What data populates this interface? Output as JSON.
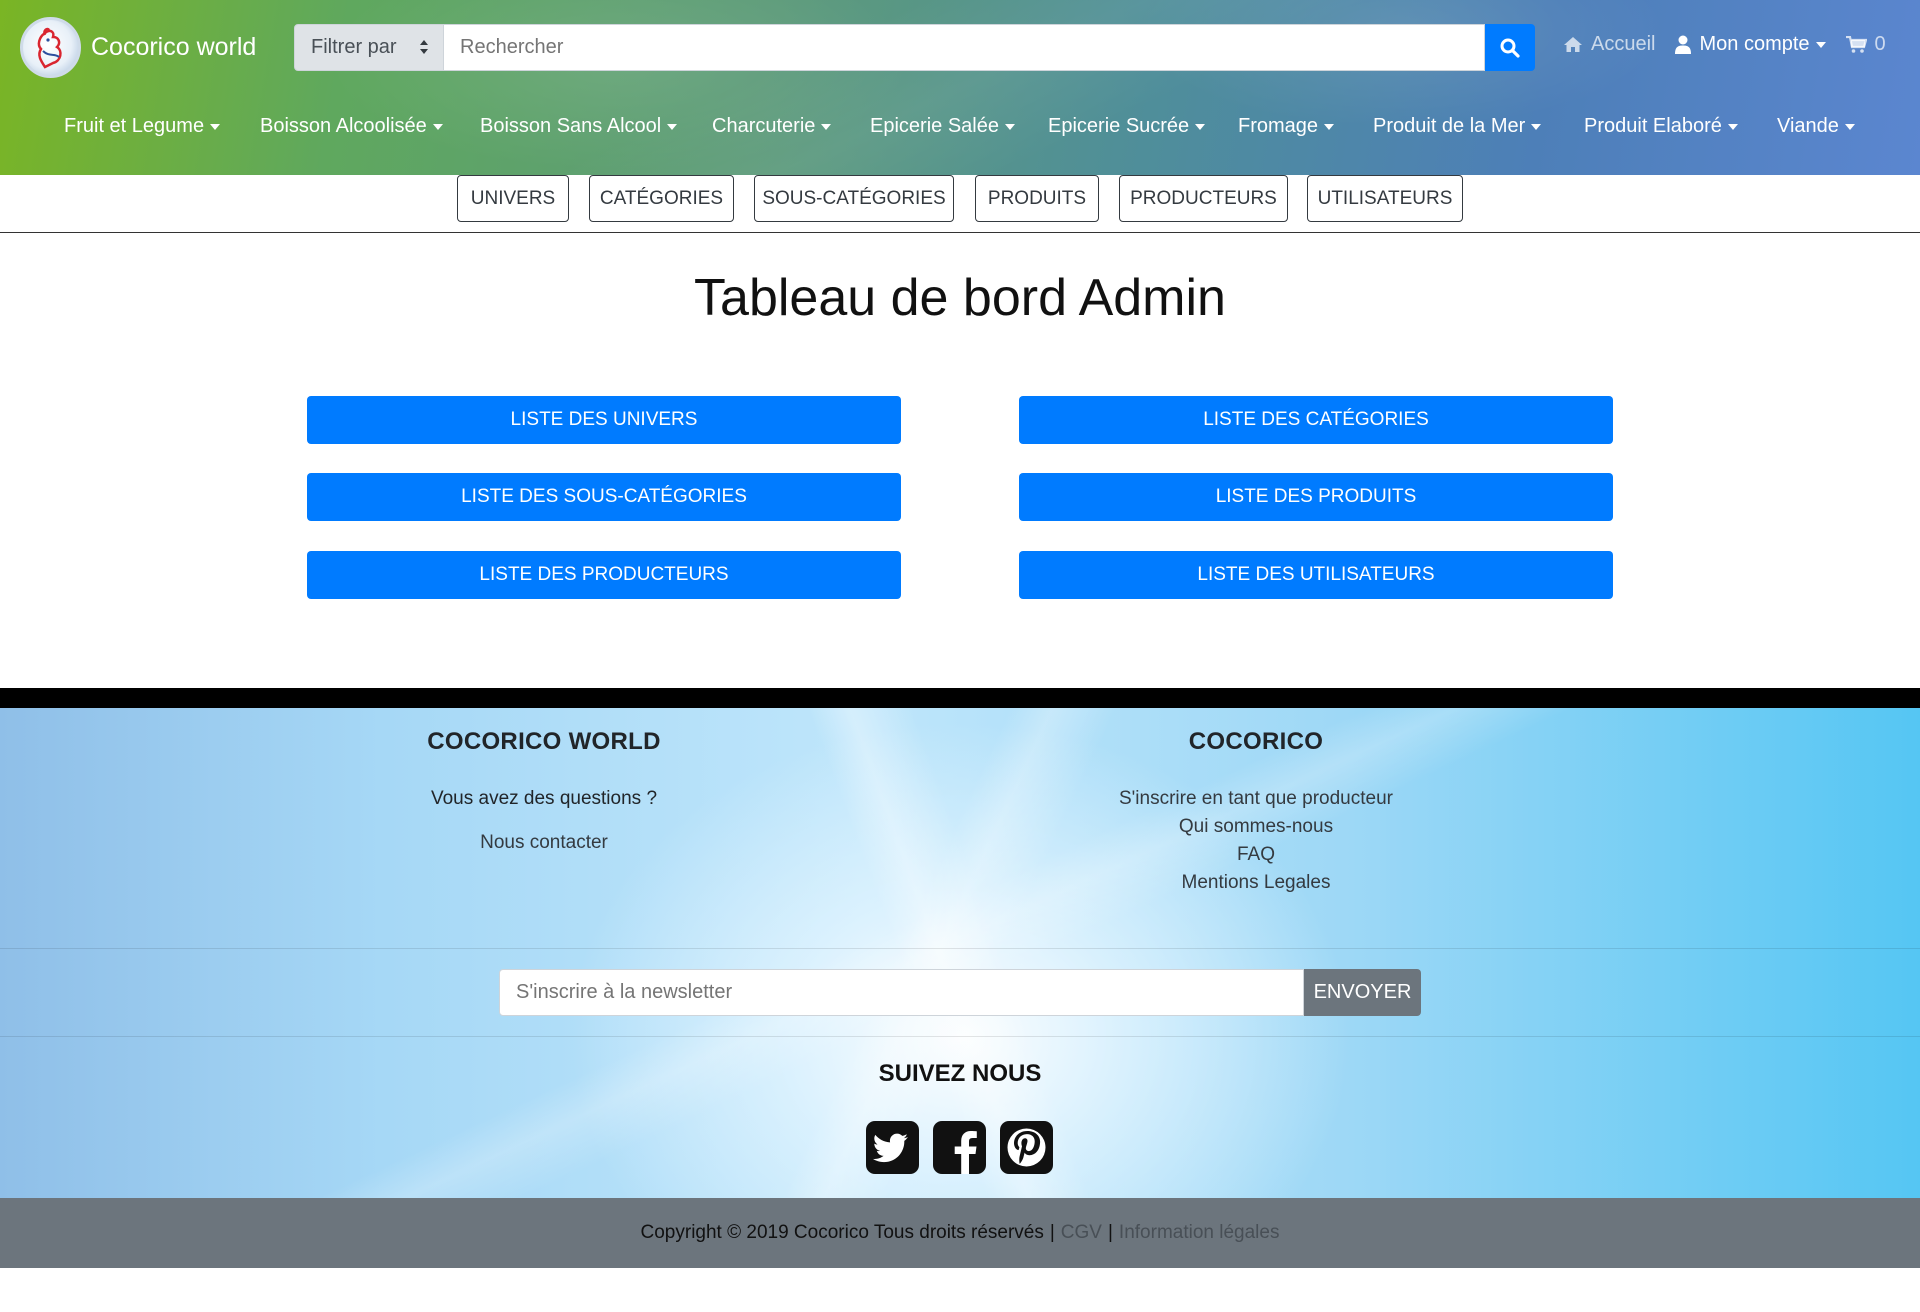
{
  "brand": {
    "name": "Cocorico world"
  },
  "search": {
    "filter_label": "Filtrer par",
    "placeholder": "Rechercher"
  },
  "top_links": {
    "home": "Accueil",
    "account": "Mon compte",
    "cart_count": "0"
  },
  "categories": [
    "Fruit et Legume",
    "Boisson Alcoolisée",
    "Boisson Sans Alcool",
    "Charcuterie",
    "Epicerie Salée",
    "Epicerie Sucrée",
    "Fromage",
    "Produit de la Mer",
    "Produit Elaboré",
    "Viande"
  ],
  "admin_tabs": [
    "Univers",
    "Catégories",
    "Sous-catégories",
    "Produits",
    "Producteurs",
    "Utilisateurs"
  ],
  "page_title": "Tableau de bord Admin",
  "dashboard_buttons": [
    "Liste des Univers",
    "Liste des Catégories",
    "Liste des Sous-catégories",
    "Liste des Produits",
    "Liste des Producteurs",
    "Liste des Utilisateurs"
  ],
  "footer": {
    "col1": {
      "title": "COCORICO WORLD",
      "question": "Vous avez des questions ?",
      "contact": "Nous contacter"
    },
    "col2": {
      "title": "COCORICO",
      "links": [
        "S'inscrire en tant que producteur",
        "Qui sommes-nous",
        "FAQ",
        "Mentions Legales"
      ]
    },
    "newsletter": {
      "placeholder": "S'inscrire à la newsletter",
      "button": "ENVOYER"
    },
    "follow_title": "SUIVEZ NOUS",
    "social_icons": [
      "twitter-icon",
      "facebook-icon",
      "pinterest-icon"
    ]
  },
  "copyright": {
    "text": "Copyright © 2019 Cocorico Tous droits réservés",
    "sep": "|",
    "cgv": "CGV",
    "legal": "Information légales"
  },
  "colors": {
    "primary": "#007bff",
    "secondary": "#6c757d"
  }
}
